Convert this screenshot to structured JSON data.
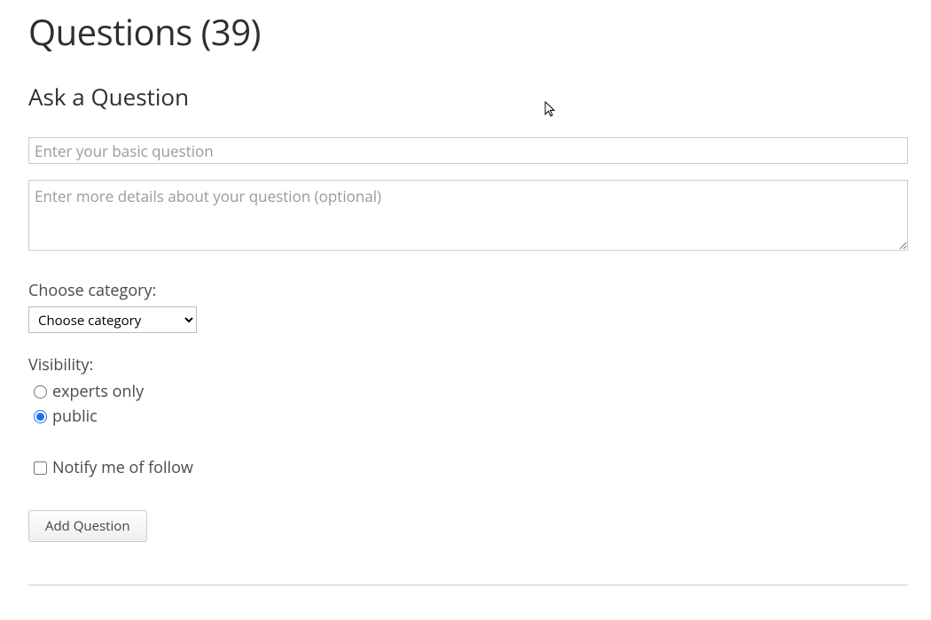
{
  "header": {
    "title": "Questions (39)"
  },
  "form": {
    "section_title": "Ask a Question",
    "question_placeholder": "Enter your basic question",
    "details_placeholder": "Enter more details about your question (optional)",
    "category_label": "Choose category:",
    "category_selected": "Choose category",
    "visibility_label": "Visibility:",
    "visibility_options": {
      "experts": "experts only",
      "public": "public"
    },
    "notify_label": "Notify me of follow",
    "submit_label": "Add Question"
  }
}
